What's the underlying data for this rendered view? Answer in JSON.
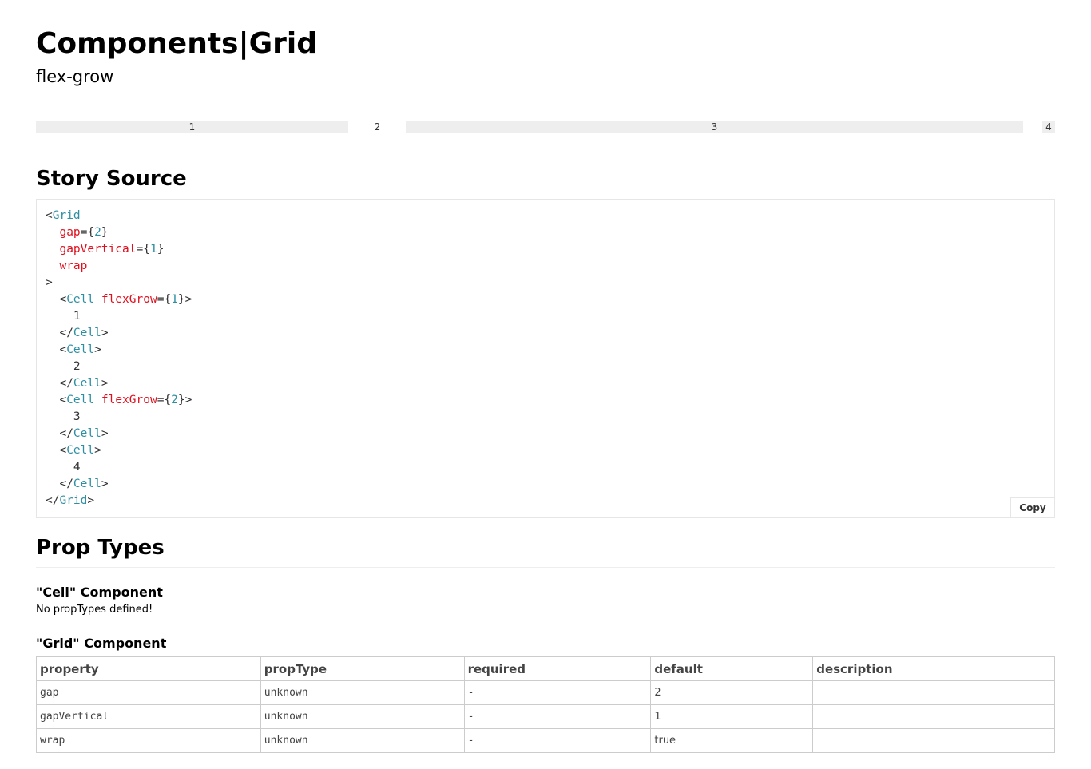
{
  "header": {
    "title": "Components|Grid",
    "subtitle": "flex-grow"
  },
  "grid_demo": {
    "cells": [
      {
        "label": "1",
        "flexGrow": 1
      },
      {
        "label": "2",
        "flexGrow": 0
      },
      {
        "label": "3",
        "flexGrow": 2
      },
      {
        "label": "4",
        "flexGrow": 0
      }
    ]
  },
  "story_source": {
    "heading": "Story Source",
    "copy_label": "Copy",
    "code": {
      "grid_tag": "Grid",
      "cell_tag": "Cell",
      "gap_attr": "gap",
      "gap_value": "2",
      "gap_vertical_attr": "gapVertical",
      "gap_vertical_value": "1",
      "wrap_attr": "wrap",
      "flex_grow_attr": "flexGrow",
      "cell1_flex": "1",
      "cell3_flex": "2",
      "cell_contents": [
        "1",
        "2",
        "3",
        "4"
      ]
    }
  },
  "prop_types": {
    "heading": "Prop Types",
    "cell_component": {
      "title": "\"Cell\" Component",
      "note": "No propTypes defined!"
    },
    "grid_component": {
      "title": "\"Grid\" Component",
      "columns": [
        "property",
        "propType",
        "required",
        "default",
        "description"
      ],
      "rows": [
        {
          "property": "gap",
          "propType": "unknown",
          "required": "-",
          "default": "2",
          "description": ""
        },
        {
          "property": "gapVertical",
          "propType": "unknown",
          "required": "-",
          "default": "1",
          "description": ""
        },
        {
          "property": "wrap",
          "propType": "unknown",
          "required": "-",
          "default": "true",
          "description": ""
        }
      ]
    }
  }
}
